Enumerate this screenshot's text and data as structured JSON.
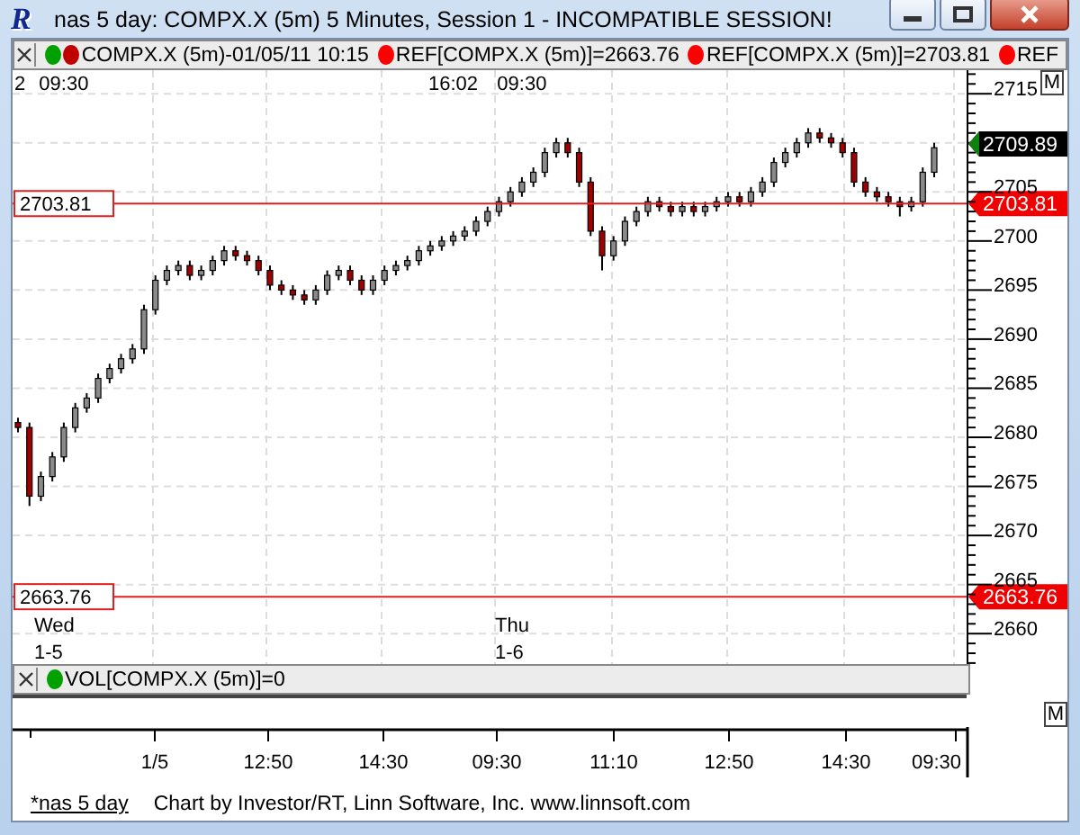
{
  "window": {
    "logo": "R",
    "title": "nas 5 day: COMPX.X (5m) 5 Minutes, Session 1 - INCOMPATIBLE SESSION!"
  },
  "legend": [
    {
      "dots": [
        {
          "color": "#00a000"
        },
        {
          "color": "#c00000"
        }
      ],
      "text": "COMPX.X (5m)-01/05/11 10:15"
    },
    {
      "dots": [
        {
          "color": "#ff0000"
        }
      ],
      "text": "REF[COMPX.X (5m)]=2663.76"
    },
    {
      "dots": [
        {
          "color": "#ff0000"
        }
      ],
      "text": "REF[COMPX.X (5m)]=2703.81"
    },
    {
      "dots": [
        {
          "color": "#ff0000"
        }
      ],
      "text": "REF"
    }
  ],
  "price_chart": {
    "ref_tags": [
      "2703.81",
      "2663.76"
    ],
    "chart_data": {
      "type": "candlestick",
      "grid": true,
      "ylim": [
        2656.9,
        2717.4
      ],
      "ref_lines": [
        {
          "axis": "y",
          "value": 2703.81,
          "label": "2703.81"
        },
        {
          "axis": "y",
          "value": 2663.76,
          "label": "2663.76"
        }
      ],
      "yticks": [
        2715,
        2705,
        2700,
        2695,
        2690,
        2685,
        2680,
        2675,
        2670,
        2665,
        2660
      ],
      "categories": [
        "2",
        null,
        null,
        null,
        "09:30",
        null,
        null,
        null,
        null,
        null,
        null,
        null,
        null,
        null,
        null,
        null,
        null,
        null,
        null,
        null,
        null,
        null,
        null,
        null,
        null,
        null,
        null,
        null,
        null,
        null,
        null,
        null,
        null,
        null,
        null,
        null,
        null,
        null,
        "16:02",
        null,
        null,
        null,
        null,
        null,
        "09:30",
        null,
        null,
        null,
        null,
        null,
        null,
        null,
        null,
        null,
        null,
        null,
        null,
        null,
        null,
        null,
        null,
        null,
        null,
        null,
        null,
        null,
        null,
        null,
        null,
        null,
        null,
        null,
        null,
        null,
        null,
        null,
        null,
        null,
        null,
        null,
        null
      ],
      "ohlc": [
        [
          2681.5,
          2682,
          2680.5,
          2681
        ],
        [
          2681,
          2681.5,
          2673,
          2674
        ],
        [
          2674,
          2676.5,
          2673.5,
          2676
        ],
        [
          2676,
          2678.5,
          2675.5,
          2678
        ],
        [
          2678,
          2681.5,
          2677.5,
          2681
        ],
        [
          2681,
          2683.5,
          2680.5,
          2683
        ],
        [
          2683,
          2684.5,
          2682.5,
          2684
        ],
        [
          2684,
          2686.5,
          2683.5,
          2686
        ],
        [
          2686,
          2687.5,
          2685.5,
          2687
        ],
        [
          2687,
          2688.5,
          2686.5,
          2688
        ],
        [
          2688,
          2689.5,
          2687.5,
          2689
        ],
        [
          2689,
          2693.5,
          2688.5,
          2693
        ],
        [
          2693,
          2696.5,
          2692.5,
          2696
        ],
        [
          2696,
          2697.5,
          2695.5,
          2697
        ],
        [
          2697,
          2698,
          2696.5,
          2697.5
        ],
        [
          2697.5,
          2698,
          2696,
          2696.5
        ],
        [
          2696.5,
          2697.5,
          2696,
          2697
        ],
        [
          2697,
          2698.5,
          2696.5,
          2698
        ],
        [
          2698,
          2699.5,
          2697.5,
          2699
        ],
        [
          2699,
          2699.5,
          2698,
          2698.5
        ],
        [
          2698.5,
          2699,
          2697.5,
          2698
        ],
        [
          2698,
          2698.5,
          2696.5,
          2697
        ],
        [
          2697,
          2697.5,
          2695,
          2695.5
        ],
        [
          2695.5,
          2696,
          2694.5,
          2695
        ],
        [
          2695,
          2695.5,
          2694,
          2694.5
        ],
        [
          2694.5,
          2695,
          2693.5,
          2694
        ],
        [
          2694,
          2695.5,
          2693.5,
          2695
        ],
        [
          2695,
          2697,
          2694.5,
          2696.5
        ],
        [
          2696.5,
          2697.5,
          2696,
          2697
        ],
        [
          2697,
          2697.5,
          2695.5,
          2696
        ],
        [
          2696,
          2696.5,
          2694.5,
          2695
        ],
        [
          2695,
          2696.5,
          2694.5,
          2696
        ],
        [
          2696,
          2697.5,
          2695.5,
          2697
        ],
        [
          2697,
          2698,
          2696.5,
          2697.5
        ],
        [
          2697.5,
          2698.5,
          2697,
          2698
        ],
        [
          2698,
          2699.5,
          2697.5,
          2699
        ],
        [
          2699,
          2700,
          2698.5,
          2699.5
        ],
        [
          2699.5,
          2700.5,
          2699,
          2700
        ],
        [
          2700,
          2701,
          2699.5,
          2700.5
        ],
        [
          2700.5,
          2701.5,
          2700,
          2701
        ],
        [
          2701,
          2702.5,
          2700.5,
          2702
        ],
        [
          2702,
          2703.5,
          2701.5,
          2703
        ],
        [
          2703,
          2704.5,
          2702.5,
          2704
        ],
        [
          2704,
          2705.5,
          2703.5,
          2705
        ],
        [
          2705,
          2706.5,
          2704.5,
          2706
        ],
        [
          2706,
          2707.5,
          2705.5,
          2707
        ],
        [
          2707,
          2709.5,
          2706.5,
          2709
        ],
        [
          2709,
          2710.5,
          2708.5,
          2710
        ],
        [
          2710,
          2710.5,
          2708.5,
          2709
        ],
        [
          2709,
          2709.5,
          2705.5,
          2706
        ],
        [
          2706,
          2706.5,
          2700.5,
          2701
        ],
        [
          2701,
          2701.5,
          2697,
          2698.5
        ],
        [
          2698.5,
          2700.5,
          2698,
          2700
        ],
        [
          2700,
          2702.5,
          2699.5,
          2702
        ],
        [
          2702,
          2703.5,
          2701.5,
          2703
        ],
        [
          2703,
          2704.5,
          2702.5,
          2704
        ],
        [
          2704,
          2704.5,
          2703,
          2703.5
        ],
        [
          2703.5,
          2704,
          2702.5,
          2703
        ],
        [
          2703,
          2704,
          2702.5,
          2703.5
        ],
        [
          2703.5,
          2704,
          2702.5,
          2703
        ],
        [
          2703,
          2704,
          2702.5,
          2703.5
        ],
        [
          2703.5,
          2704.5,
          2703,
          2704
        ],
        [
          2704,
          2705,
          2703.5,
          2704.5
        ],
        [
          2704.5,
          2705,
          2703.5,
          2704
        ],
        [
          2704,
          2705.5,
          2703.5,
          2705
        ],
        [
          2705,
          2706.5,
          2704.5,
          2706
        ],
        [
          2706,
          2708.5,
          2705.5,
          2708
        ],
        [
          2708,
          2709.5,
          2707.5,
          2709
        ],
        [
          2709,
          2710.5,
          2708.5,
          2710
        ],
        [
          2710,
          2711.5,
          2709.5,
          2711
        ],
        [
          2711,
          2711.5,
          2710,
          2710.5
        ],
        [
          2710.5,
          2711,
          2709.5,
          2710
        ],
        [
          2710,
          2710.5,
          2708.5,
          2709
        ],
        [
          2709,
          2709.5,
          2705.5,
          2706
        ],
        [
          2706,
          2706.5,
          2704.5,
          2705
        ],
        [
          2705,
          2705.5,
          2704,
          2704.5
        ],
        [
          2704.5,
          2705,
          2703.5,
          2704
        ],
        [
          2704,
          2704.5,
          2702.5,
          2703.5
        ],
        [
          2703.5,
          2704.5,
          2703,
          2704
        ],
        [
          2704,
          2707.5,
          2703.5,
          2707
        ],
        [
          2707,
          2710,
          2706.5,
          2709.5
        ]
      ]
    },
    "last_price": "2709.89",
    "days": [
      {
        "day": "Wed",
        "date": "1-5"
      },
      {
        "day": "Thu",
        "date": "1-6"
      }
    ],
    "mode_button": "M"
  },
  "volume": {
    "legend": {
      "color": "#00a000",
      "text": "VOL[COMPX.X (5m)]=0"
    },
    "mode_button": "M"
  },
  "time_axis": [
    "1/5",
    "12:50",
    "14:30",
    "09:30",
    "11:10",
    "12:50",
    "14:30",
    "09:30"
  ],
  "footer": {
    "tab": "*nas 5 day",
    "credit": "Chart by Investor/RT, Linn Software, Inc. www.linnsoft.com"
  }
}
